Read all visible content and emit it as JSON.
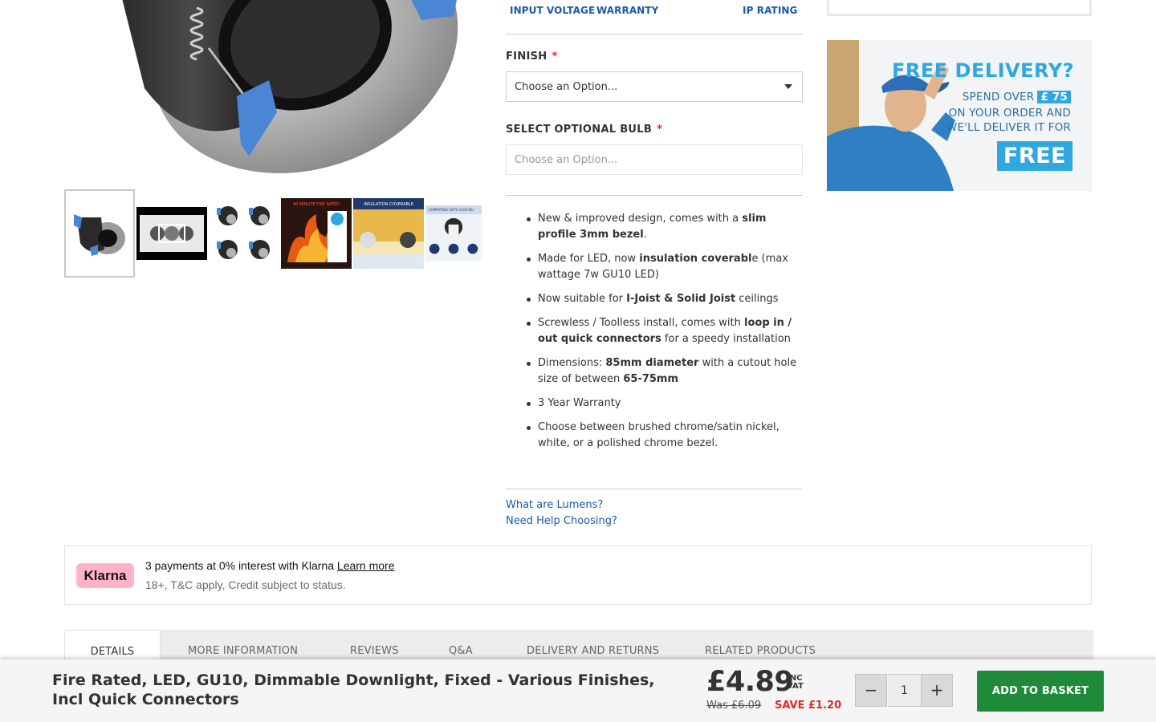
{
  "specs": {
    "input_voltage": "INPUT VOLTAGE",
    "warranty": "WARRANTY",
    "ip_rating": "IP RATING"
  },
  "options": {
    "finish": {
      "label": "FINISH",
      "required_mark": "*",
      "value": "Choose an Option..."
    },
    "bulb": {
      "label": "SELECT OPTIONAL BULB",
      "required_mark": "*",
      "value": "Choose an Option..."
    }
  },
  "thumbnails": [
    {
      "icon": "downlight-icon"
    },
    {
      "icon": "video-thumbnail"
    },
    {
      "icon": "four-downlights-icon"
    },
    {
      "icon": "fire-rated-image",
      "caption": "90-MINUTE FIRE RATED"
    },
    {
      "icon": "insulation-coverable-image",
      "caption": "INSULATION COVERABLE"
    },
    {
      "icon": "compatible-image",
      "caption": "COMPATIBLE WITH GU10 BU"
    }
  ],
  "features": [
    [
      "New & improved design, comes with a ",
      "slim profile 3mm bezel",
      "."
    ],
    [
      "Made for LED, now ",
      "insulation coverabl",
      "e (max wattage 7w GU10 LED)"
    ],
    [
      "Now suitable for ",
      "I-Joist & Solid Joist",
      " ceilings"
    ],
    [
      "Screwless / Toolless install, comes with ",
      "loop in / out quick connectors",
      " for a speedy installation"
    ],
    [
      "Dimensions: ",
      "85mm diameter",
      " with a cutout hole size of between ",
      "65-75mm"
    ],
    [
      "3 Year Warranty"
    ],
    [
      "Choose between brushed chrome/satin nickel, white, or a polished chrome bezel."
    ]
  ],
  "links": {
    "lumens": "What are Lumens?",
    "help": "Need Help Choosing?"
  },
  "promo": {
    "title": "FREE DELIVERY?",
    "line1": "SPEND OVER",
    "amount": "£ 75",
    "line2": "ON YOUR ORDER AND",
    "line3": "WE'LL DELIVER IT FOR",
    "free": "FREE"
  },
  "klarna": {
    "badge": "Klarna",
    "line1": "3 payments at 0% interest with Klarna",
    "learn_more": "Learn more",
    "line2": "18+, T&C apply, Credit subject to status."
  },
  "tabs": [
    "DETAILS",
    "MORE INFORMATION",
    "REVIEWS",
    "Q&A",
    "DELIVERY AND RETURNS",
    "RELATED PRODUCTS"
  ],
  "sticky": {
    "title": "Fire Rated, LED, GU10, Dimmable Downlight, Fixed - Various Finishes, Incl Quick Connectors",
    "price": "£4.89",
    "inc": "INC",
    "vat": "VAT",
    "was": "Was £6.09",
    "save": "SAVE £1.20",
    "minus": "−",
    "plus": "+",
    "quantity": "1",
    "add_to_basket": "ADD TO BASKET"
  },
  "colors": {
    "link_blue": "#1a5aa6",
    "required_red": "#e02b27",
    "add_button_green": "#1f8a39",
    "klarna_pink": "#ffb3c7",
    "promo_blue": "#2fa7e0"
  }
}
